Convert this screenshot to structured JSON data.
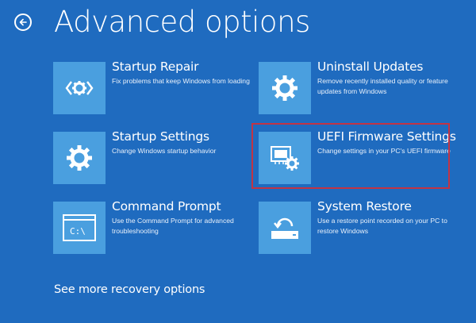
{
  "header": {
    "title": "Advanced options",
    "back_icon": "back-arrow-icon"
  },
  "tiles": [
    {
      "id": "startup-repair",
      "title": "Startup Repair",
      "description": "Fix problems that keep Windows from loading",
      "icon": "code-brackets-gear-icon"
    },
    {
      "id": "uninstall-updates",
      "title": "Uninstall Updates",
      "description": "Remove recently installed quality or feature updates from Windows",
      "icon": "gear-icon"
    },
    {
      "id": "startup-settings",
      "title": "Startup Settings",
      "description": "Change Windows startup behavior",
      "icon": "gear-icon"
    },
    {
      "id": "uefi-firmware-settings",
      "title": "UEFI Firmware Settings",
      "description": "Change settings in your PC's UEFI firmware",
      "icon": "firmware-chip-gear-icon"
    },
    {
      "id": "command-prompt",
      "title": "Command Prompt",
      "description": "Use the Command Prompt for advanced troubleshooting",
      "icon": "console-window-icon",
      "icon_text": "C:\\"
    },
    {
      "id": "system-restore",
      "title": "System Restore",
      "description": "Use a restore point recorded on your PC to restore Windows",
      "icon": "restore-drive-icon"
    }
  ],
  "footer": {
    "more_link": "See more recovery options"
  },
  "colors": {
    "background": "#1f6bbf",
    "tile_icon": "#4a9fdf",
    "highlight": "#c23444",
    "text": "#ffffff"
  }
}
